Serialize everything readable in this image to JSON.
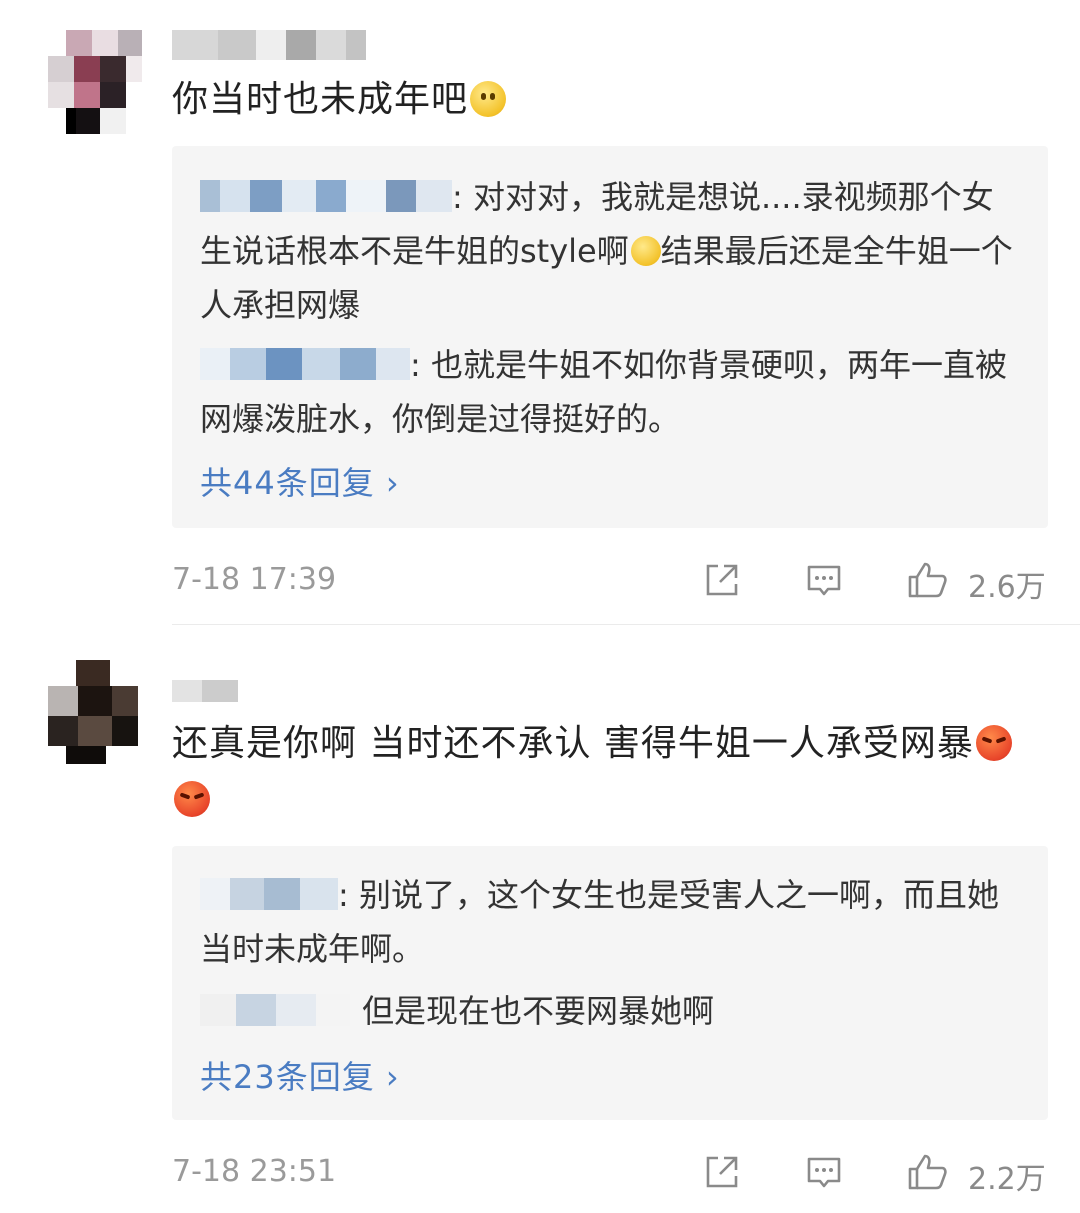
{
  "comments": [
    {
      "text": "你当时也未成年吧",
      "emoji": "slight-smile-emoji",
      "replies": [
        {
          "text": ": 对对对，我就是想说....录视频那个女生说话根本不是牛姐的style啊",
          "emoji": "squint-emoji",
          "text2": "结果最后还是全牛姐一个人承担网爆"
        },
        {
          "text": ": 也就是牛姐不如你背景硬呗，两年一直被网爆泼脏水，你倒是过得挺好的。"
        }
      ],
      "more_replies": "共44条回复 ›",
      "timestamp": "7-18 17:39",
      "likes": "2.6万"
    },
    {
      "text": "还真是你啊 当时还不承认 害得牛姐一人承受网暴",
      "emoji": "angry-emoji",
      "replies": [
        {
          "text": ": 别说了，这个女生也是受害人之一啊，而且她当时未成年啊。"
        },
        {
          "text": "但是现在也不要网暴她啊"
        }
      ],
      "more_replies": "共23条回复 ›",
      "timestamp": "7-18 23:51",
      "likes": "2.2万"
    }
  ],
  "colors": {
    "link": "#4a7cc2",
    "meta": "#9a9a9a",
    "reply_bg": "#f5f5f5"
  }
}
